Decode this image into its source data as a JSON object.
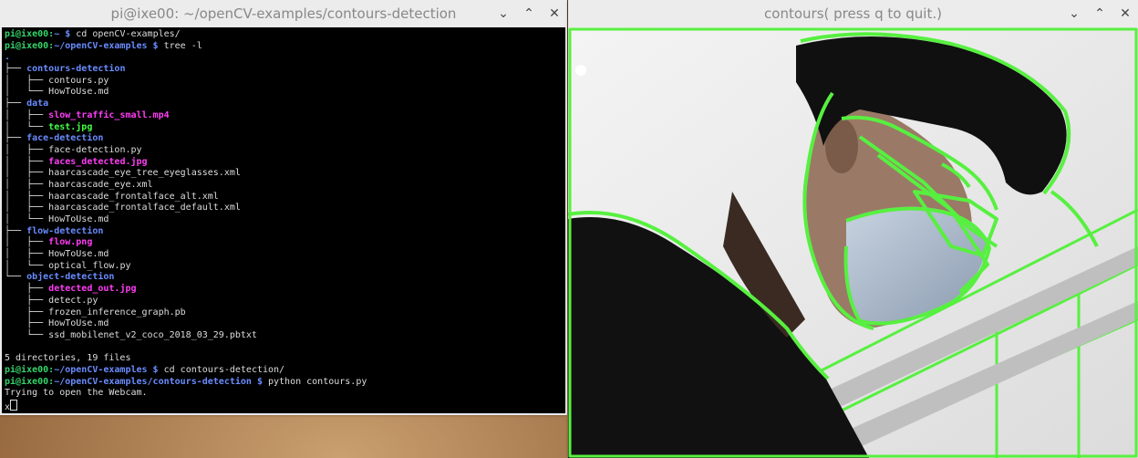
{
  "terminal": {
    "title": "pi@ixe00: ~/openCV-examples/contours-detection",
    "lines": [
      [
        [
          "pi@ixe00:",
          "p-green"
        ],
        [
          "~ $ ",
          "p-blue"
        ],
        [
          "cd openCV-examples/",
          "tree"
        ]
      ],
      [
        [
          "pi@ixe00:",
          "p-green"
        ],
        [
          "~/openCV-examples $ ",
          "p-blue"
        ],
        [
          "tree -l",
          "tree"
        ]
      ],
      [
        [
          ".",
          "dir"
        ]
      ],
      [
        [
          "├── ",
          "tree"
        ],
        [
          "contours-detection",
          "dir"
        ]
      ],
      [
        [
          "│   ├── ",
          "tree"
        ],
        [
          "contours.py",
          "tree"
        ]
      ],
      [
        [
          "│   └── ",
          "tree"
        ],
        [
          "HowToUse.md",
          "tree"
        ]
      ],
      [
        [
          "├── ",
          "tree"
        ],
        [
          "data",
          "dir"
        ]
      ],
      [
        [
          "│   ├── ",
          "tree"
        ],
        [
          "slow_traffic_small.mp4",
          "img"
        ]
      ],
      [
        [
          "│   └── ",
          "tree"
        ],
        [
          "test.jpg",
          "exe"
        ]
      ],
      [
        [
          "├── ",
          "tree"
        ],
        [
          "face-detection",
          "dir"
        ]
      ],
      [
        [
          "│   ├── ",
          "tree"
        ],
        [
          "face-detection.py",
          "tree"
        ]
      ],
      [
        [
          "│   ├── ",
          "tree"
        ],
        [
          "faces_detected.jpg",
          "img"
        ]
      ],
      [
        [
          "│   ├── ",
          "tree"
        ],
        [
          "haarcascade_eye_tree_eyeglasses.xml",
          "tree"
        ]
      ],
      [
        [
          "│   ├── ",
          "tree"
        ],
        [
          "haarcascade_eye.xml",
          "tree"
        ]
      ],
      [
        [
          "│   ├── ",
          "tree"
        ],
        [
          "haarcascade_frontalface_alt.xml",
          "tree"
        ]
      ],
      [
        [
          "│   ├── ",
          "tree"
        ],
        [
          "haarcascade_frontalface_default.xml",
          "tree"
        ]
      ],
      [
        [
          "│   └── ",
          "tree"
        ],
        [
          "HowToUse.md",
          "tree"
        ]
      ],
      [
        [
          "├── ",
          "tree"
        ],
        [
          "flow-detection",
          "dir"
        ]
      ],
      [
        [
          "│   ├── ",
          "tree"
        ],
        [
          "flow.png",
          "img"
        ]
      ],
      [
        [
          "│   ├── ",
          "tree"
        ],
        [
          "HowToUse.md",
          "tree"
        ]
      ],
      [
        [
          "│   └── ",
          "tree"
        ],
        [
          "optical_flow.py",
          "tree"
        ]
      ],
      [
        [
          "└── ",
          "tree"
        ],
        [
          "object-detection",
          "dir"
        ]
      ],
      [
        [
          "    ├── ",
          "tree"
        ],
        [
          "detected_out.jpg",
          "img"
        ]
      ],
      [
        [
          "    ├── ",
          "tree"
        ],
        [
          "detect.py",
          "tree"
        ]
      ],
      [
        [
          "    ├── ",
          "tree"
        ],
        [
          "frozen_inference_graph.pb",
          "tree"
        ]
      ],
      [
        [
          "    ├── ",
          "tree"
        ],
        [
          "HowToUse.md",
          "tree"
        ]
      ],
      [
        [
          "    └── ",
          "tree"
        ],
        [
          "ssd_mobilenet_v2_coco_2018_03_29.pbtxt",
          "tree"
        ]
      ],
      [
        [
          "",
          "tree"
        ]
      ],
      [
        [
          "5 directories, 19 files",
          "tree"
        ]
      ],
      [
        [
          "pi@ixe00:",
          "p-green"
        ],
        [
          "~/openCV-examples $ ",
          "p-blue"
        ],
        [
          "cd contours-detection/",
          "tree"
        ]
      ],
      [
        [
          "pi@ixe00:",
          "p-green"
        ],
        [
          "~/openCV-examples/contours-detection $ ",
          "p-blue"
        ],
        [
          "python contours.py",
          "tree"
        ]
      ],
      [
        [
          "Trying to open the Webcam.",
          "tree"
        ]
      ],
      [
        [
          "x",
          "tree"
        ]
      ]
    ]
  },
  "camera": {
    "title": "contours( press q to quit.)"
  },
  "window_controls": {
    "minimize": "⌄",
    "maximize": "⌃",
    "close": "✕"
  },
  "colors": {
    "contour": "#57f040",
    "terminal_bg": "#000000",
    "dir": "#6a8cff",
    "image": "#ff3df5"
  }
}
